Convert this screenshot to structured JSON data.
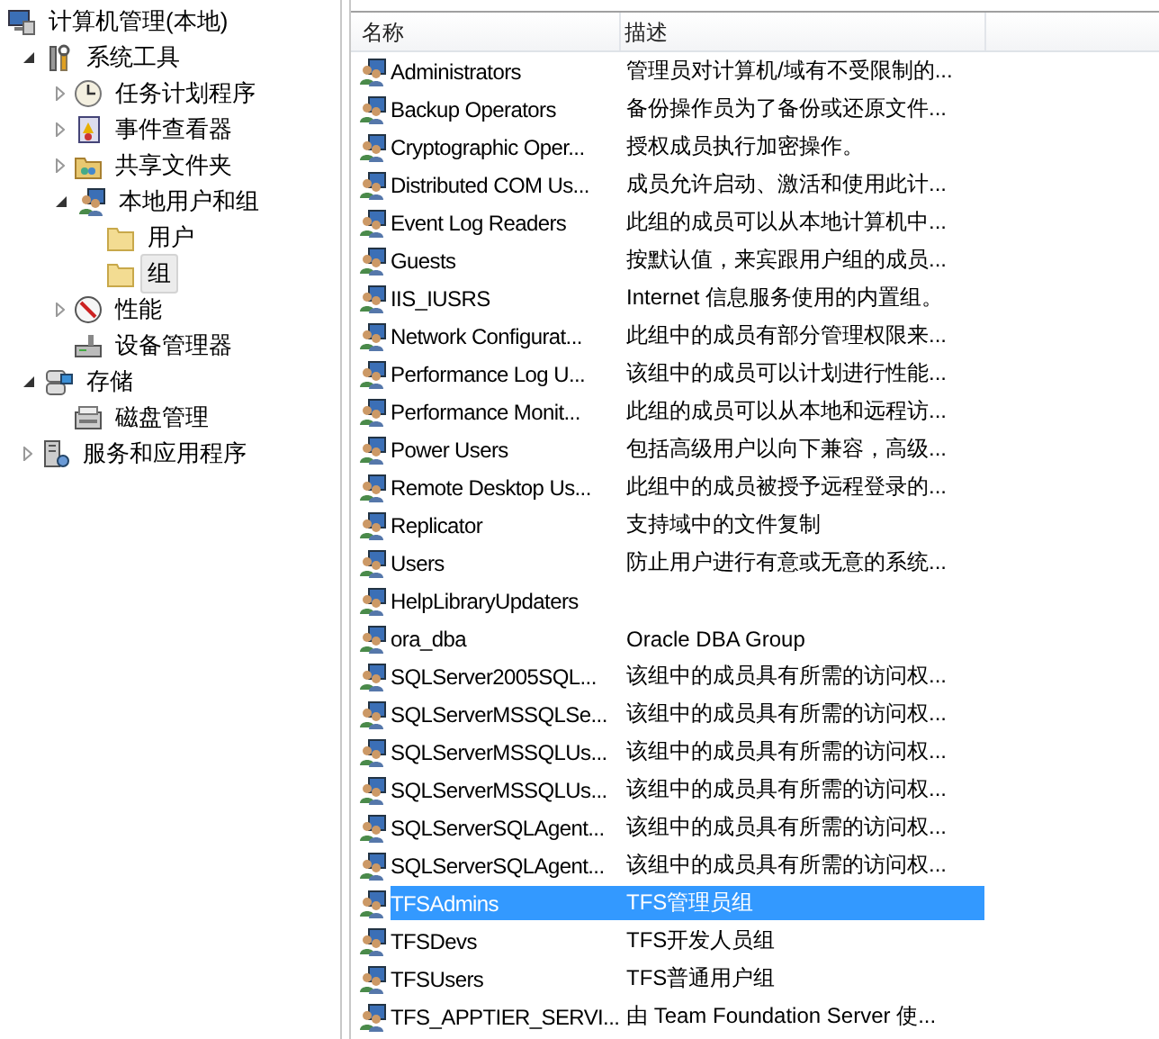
{
  "tree": [
    {
      "label": "计算机管理(本地)",
      "kind": "computer",
      "selected": false,
      "children": [
        {
          "label": "系统工具",
          "kind": "tools",
          "selected": false,
          "expanded": true,
          "children": [
            {
              "label": "任务计划程序",
              "kind": "clock",
              "selected": false,
              "expanded": false
            },
            {
              "label": "事件查看器",
              "kind": "event",
              "selected": false,
              "expanded": false
            },
            {
              "label": "共享文件夹",
              "kind": "share",
              "selected": false,
              "expanded": false
            },
            {
              "label": "本地用户和组",
              "kind": "users",
              "selected": false,
              "expanded": true,
              "children": [
                {
                  "label": "用户",
                  "kind": "folder",
                  "selected": false
                },
                {
                  "label": "组",
                  "kind": "folder",
                  "selected": true
                }
              ]
            },
            {
              "label": "性能",
              "kind": "perf",
              "selected": false,
              "expanded": false
            },
            {
              "label": "设备管理器",
              "kind": "device",
              "selected": false
            }
          ]
        },
        {
          "label": "存储",
          "kind": "storage",
          "selected": false,
          "expanded": true,
          "children": [
            {
              "label": "磁盘管理",
              "kind": "disk",
              "selected": false
            }
          ]
        },
        {
          "label": "服务和应用程序",
          "kind": "services",
          "selected": false,
          "expanded": false
        }
      ]
    }
  ],
  "list": {
    "columns": [
      "名称",
      "描述"
    ],
    "rows": [
      {
        "name": "Administrators",
        "description": "管理员对计算机/域有不受限制的...",
        "selected": false
      },
      {
        "name": "Backup Operators",
        "description": "备份操作员为了备份或还原文件...",
        "selected": false
      },
      {
        "name": "Cryptographic Oper...",
        "description": "授权成员执行加密操作。",
        "selected": false
      },
      {
        "name": "Distributed COM Us...",
        "description": "成员允许启动、激活和使用此计...",
        "selected": false
      },
      {
        "name": "Event Log Readers",
        "description": "此组的成员可以从本地计算机中...",
        "selected": false
      },
      {
        "name": "Guests",
        "description": "按默认值，来宾跟用户组的成员...",
        "selected": false
      },
      {
        "name": "IIS_IUSRS",
        "description": "Internet 信息服务使用的内置组。",
        "selected": false
      },
      {
        "name": "Network Configurat...",
        "description": "此组中的成员有部分管理权限来...",
        "selected": false
      },
      {
        "name": "Performance Log U...",
        "description": "该组中的成员可以计划进行性能...",
        "selected": false
      },
      {
        "name": "Performance Monit...",
        "description": "此组的成员可以从本地和远程访...",
        "selected": false
      },
      {
        "name": "Power Users",
        "description": "包括高级用户以向下兼容，高级...",
        "selected": false
      },
      {
        "name": "Remote Desktop Us...",
        "description": "此组中的成员被授予远程登录的...",
        "selected": false
      },
      {
        "name": "Replicator",
        "description": "支持域中的文件复制",
        "selected": false
      },
      {
        "name": "Users",
        "description": "防止用户进行有意或无意的系统...",
        "selected": false
      },
      {
        "name": "HelpLibraryUpdaters",
        "selected": false
      },
      {
        "name": "ora_dba",
        "description": "Oracle DBA Group",
        "selected": false
      },
      {
        "name": "SQLServer2005SQL...",
        "description": "该组中的成员具有所需的访问权...",
        "selected": false
      },
      {
        "name": "SQLServerMSSQLSe...",
        "description": "该组中的成员具有所需的访问权...",
        "selected": false
      },
      {
        "name": "SQLServerMSSQLUs...",
        "description": "该组中的成员具有所需的访问权...",
        "selected": false
      },
      {
        "name": "SQLServerMSSQLUs...",
        "description": "该组中的成员具有所需的访问权...",
        "selected": false
      },
      {
        "name": "SQLServerSQLAgent...",
        "description": "该组中的成员具有所需的访问权...",
        "selected": false
      },
      {
        "name": "SQLServerSQLAgent...",
        "description": "该组中的成员具有所需的访问权...",
        "selected": false
      },
      {
        "name": "TFSAdmins",
        "description": "TFS管理员组",
        "selected": true
      },
      {
        "name": "TFSDevs",
        "description": "TFS开发人员组",
        "selected": false
      },
      {
        "name": "TFSUsers",
        "description": "TFS普通用户组",
        "selected": false
      },
      {
        "name": "TFS_APPTIER_SERVI...",
        "description": "由 Team Foundation Server 使...",
        "selected": false
      }
    ]
  }
}
